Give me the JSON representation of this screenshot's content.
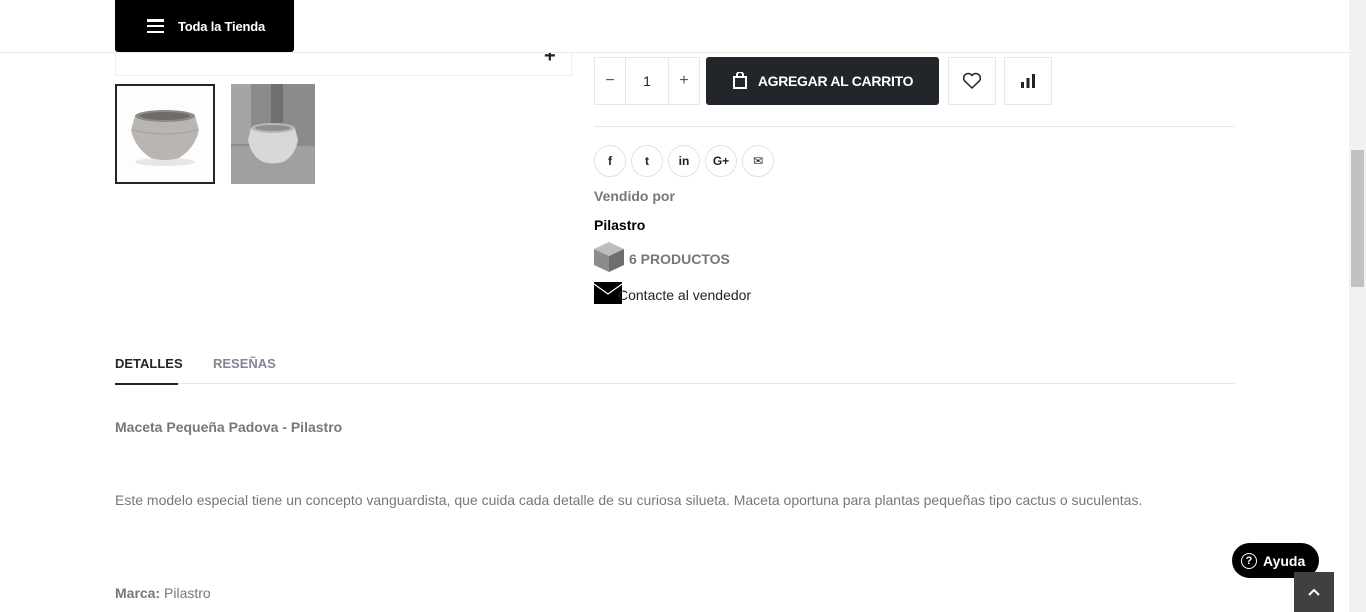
{
  "header": {
    "menu_label": "Toda la Tienda"
  },
  "gallery": {
    "zoom_symbol": "+",
    "thumbnails": [
      {
        "alt": "",
        "active": true
      },
      {
        "alt": "",
        "active": false
      }
    ]
  },
  "cart": {
    "minus": "−",
    "quantity": "1",
    "plus": "+",
    "add_label": "AGREGAR AL CARRITO"
  },
  "share": {
    "networks": [
      "facebook-icon",
      "twitter-icon",
      "linkedin-icon",
      "google-plus-icon",
      "email-icon"
    ],
    "glyphs": [
      "f",
      "t",
      "in",
      "G+",
      "✉"
    ]
  },
  "vendor": {
    "sold_by_label": "Vendido por",
    "name": "Pilastro",
    "products_label": "6 PRODUCTOS",
    "contact_label": "Contacte al vendedor"
  },
  "tabs": {
    "details": "DETALLES",
    "reviews": "RESEÑAS"
  },
  "description": {
    "title": "Maceta Pequeña Padova - Pilastro",
    "body": "Este modelo especial tiene un concepto vanguardista, que cuida cada detalle de su curiosa silueta. Maceta oportuna para plantas pequeñas tipo cactus o suculentas.",
    "brand_label": "Marca:",
    "brand_value": "Pilastro"
  },
  "help": {
    "label": "Ayuda"
  },
  "colors": {
    "primary_dark": "#222529",
    "muted_text": "#777777",
    "border": "#e7e7e7"
  }
}
